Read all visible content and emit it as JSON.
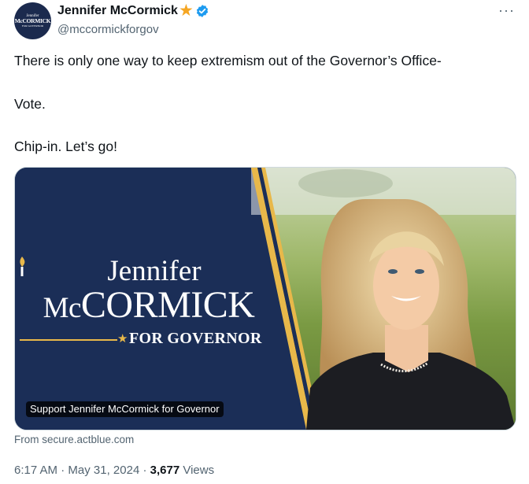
{
  "author": {
    "name": "Jennifer McCormick",
    "handle": "@mccormickforgov",
    "avatar_text": [
      "Jennifer",
      "McCORMICK",
      "FOR GOVERNOR"
    ],
    "icons": [
      "star-emoji-icon",
      "verified-badge-icon",
      "more-options-icon"
    ]
  },
  "tweet": {
    "lines": [
      "There is only one way to keep extremism out of the Governor’s Office-",
      "Vote.",
      "Chip-in. Let’s go!"
    ]
  },
  "card": {
    "logo_first": "Jennifer",
    "logo_last_mc": "Mc",
    "logo_last_rest": "CORMICK",
    "logo_sub": "FOR GOVERNOR",
    "overlay_title": "Support Jennifer McCormick for Governor",
    "source": "From secure.actblue.com"
  },
  "meta": {
    "time": "6:17 AM",
    "sep1": " · ",
    "date": "May 31, 2024",
    "sep2": " · ",
    "views_count": "3,677",
    "views_label": " Views"
  },
  "colors": {
    "navy": "#1b2e57",
    "gold": "#e8b84a",
    "verified_blue": "#1d9bf0",
    "muted_text": "#536471"
  }
}
